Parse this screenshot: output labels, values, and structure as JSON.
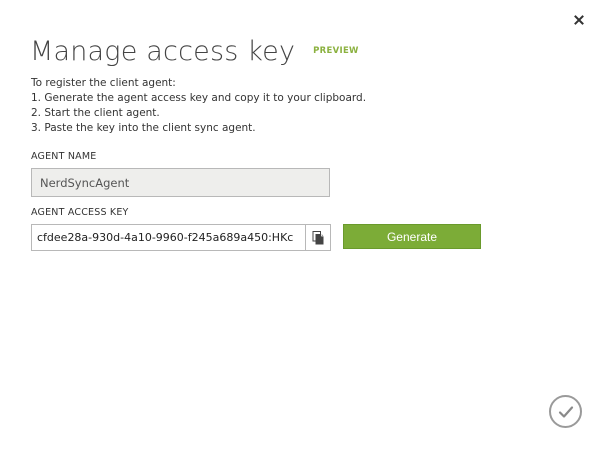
{
  "dialog": {
    "title": "Manage access key",
    "badge": "PREVIEW",
    "close_icon": "close-icon",
    "ok_icon": "checkmark-icon"
  },
  "instructions": {
    "intro": "To register the client agent:",
    "steps": [
      "1. Generate the agent access key and copy it to your clipboard.",
      "2. Start the client agent.",
      "3. Paste the key into the client sync agent."
    ]
  },
  "agent_name": {
    "label": "AGENT NAME",
    "value": "NerdSyncAgent"
  },
  "agent_key": {
    "label": "AGENT ACCESS KEY",
    "value": "cfdee28a-930d-4a10-9960-f245a689a450:HKc",
    "copy_icon": "copy-icon"
  },
  "generate": {
    "label": "Generate"
  },
  "colors": {
    "accent": "#7cac37",
    "badge": "#8bb13f",
    "readonly_bg": "#eeeeec"
  }
}
